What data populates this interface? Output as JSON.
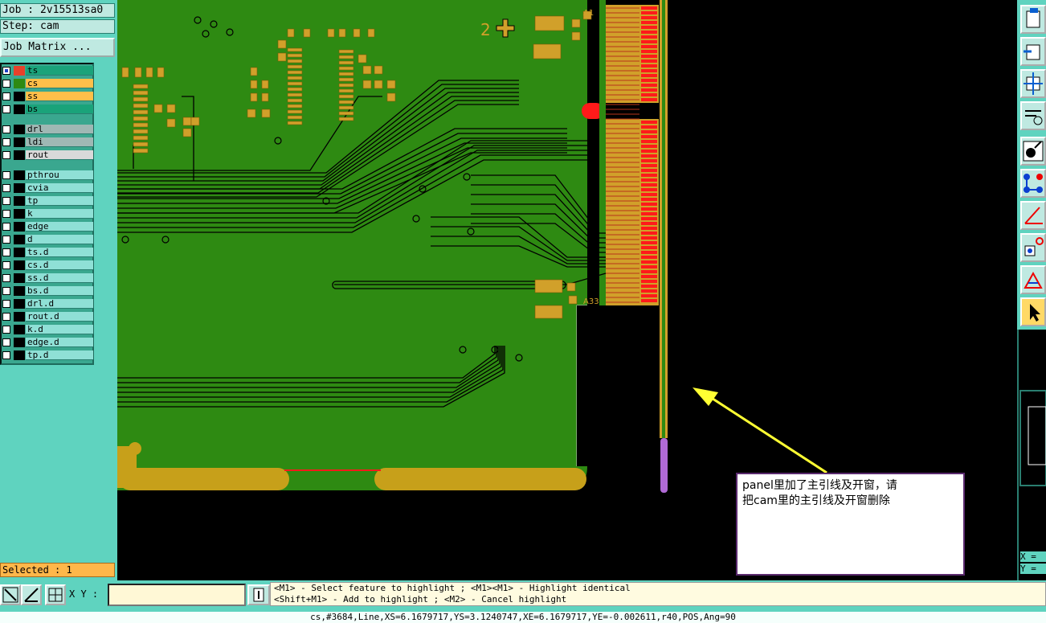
{
  "job": {
    "label": "Job : 2v15513sa0"
  },
  "step": {
    "label": "Step: cam"
  },
  "job_matrix": {
    "label": "Job Matrix ..."
  },
  "layers": [
    {
      "name": "ts",
      "color": "#1aa37a",
      "checked": true
    },
    {
      "name": "cs",
      "color": "#ffbf4a",
      "checked": false
    },
    {
      "name": "ss",
      "color": "#ffbf4a",
      "checked": false
    },
    {
      "name": "bs",
      "color": "#1aa37a",
      "checked": false
    },
    {
      "name": "drl",
      "color": "#9fb8b4",
      "checked": false
    },
    {
      "name": "ldi",
      "color": "#9fb8b4",
      "checked": false
    },
    {
      "name": "rout",
      "color": "#d9d9d9",
      "checked": false
    },
    {
      "name": "pthrou",
      "color": "#8fe0d6",
      "checked": false
    },
    {
      "name": "cvia",
      "color": "#8fe0d6",
      "checked": false
    },
    {
      "name": "tp",
      "color": "#8fe0d6",
      "checked": false
    },
    {
      "name": "k",
      "color": "#8fe0d6",
      "checked": false
    },
    {
      "name": "edge",
      "color": "#8fe0d6",
      "checked": false
    },
    {
      "name": "d",
      "color": "#8fe0d6",
      "checked": false
    },
    {
      "name": "ts.d",
      "color": "#8fe0d6",
      "checked": false
    },
    {
      "name": "cs.d",
      "color": "#8fe0d6",
      "checked": false
    },
    {
      "name": "ss.d",
      "color": "#8fe0d6",
      "checked": false
    },
    {
      "name": "bs.d",
      "color": "#8fe0d6",
      "checked": false
    },
    {
      "name": "drl.d",
      "color": "#8fe0d6",
      "checked": false
    },
    {
      "name": "rout.d",
      "color": "#8fe0d6",
      "checked": false
    },
    {
      "name": "k.d",
      "color": "#8fe0d6",
      "checked": false
    },
    {
      "name": "edge.d",
      "color": "#8fe0d6",
      "checked": false
    },
    {
      "name": "tp.d",
      "color": "#8fe0d6",
      "checked": false
    }
  ],
  "selected": {
    "label": "Selected : 1"
  },
  "canvas": {
    "marker_2": "2",
    "pin_label_top": "A1",
    "pin_label_bottom": "A33"
  },
  "annotation": {
    "text": "panel里加了主引线及开窗，请\n把cam里的主引线及开窗删除"
  },
  "coords": {
    "x_label": "X =",
    "y_label": "Y ="
  },
  "xy": {
    "label": "X Y :",
    "value": ""
  },
  "hints": {
    "line1": "<M1> - Select feature to highlight ; <M1><M1> - Highlight identical",
    "line2": "<Shift+M1> - Add to highlight ; <M2> - Cancel highlight"
  },
  "status": {
    "text": "cs,#3684,Line,XS=6.1679717,YS=3.1240747,XE=6.1679717,YE=-0.002611,r40,POS,Ang=90"
  },
  "colors": {
    "board": "#2e8a12",
    "pad": "#d1a02a",
    "finger": "#ff1a1a",
    "arrow": "#ffff33",
    "lead": "#b06ad6"
  }
}
